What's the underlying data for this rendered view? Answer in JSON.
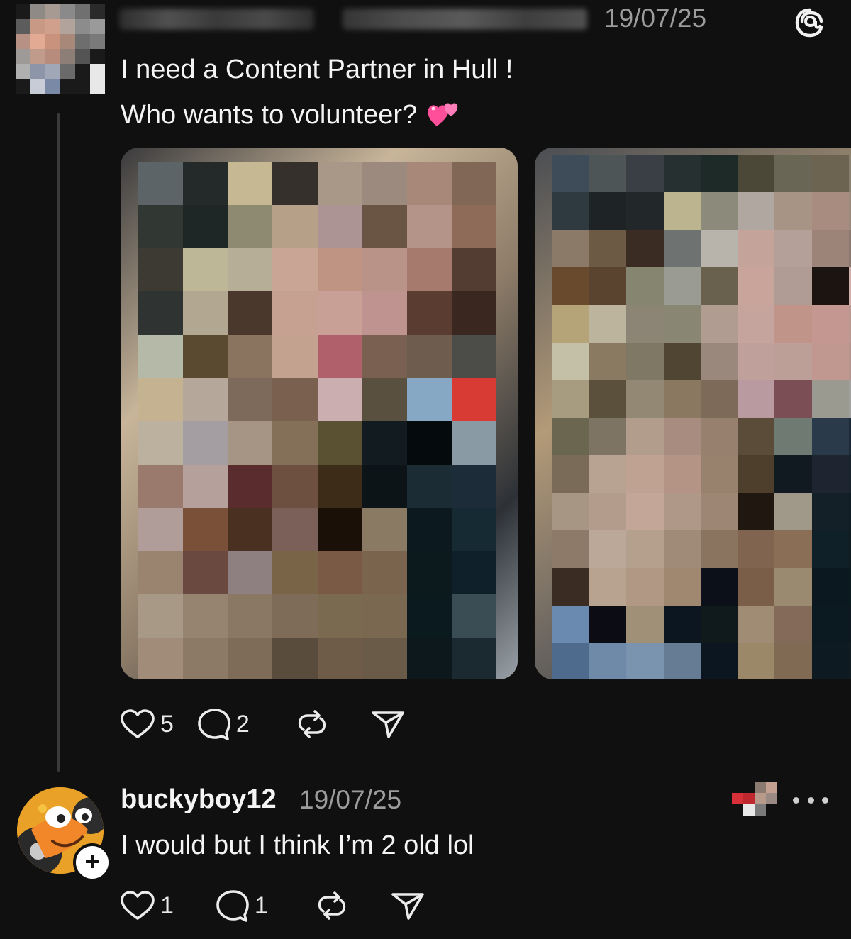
{
  "post": {
    "date": "19/07/25",
    "text_line1": "I need a Content Partner in Hull !",
    "text_line2": "Who wants to volunteer?",
    "emoji_icon": "two-hearts-emoji",
    "author_avatar_icon": "pixelated-avatar",
    "author_name_redacted": true,
    "photos": [
      {
        "name": "photo-1",
        "redacted": true
      },
      {
        "name": "photo-2",
        "redacted": true
      }
    ],
    "actions": {
      "like_count": "5",
      "reply_count": "2",
      "repost_count": "",
      "share_count": ""
    }
  },
  "reply": {
    "username": "buckyboy12",
    "date": "19/07/25",
    "text": "I would but I think I’m 2 old lol",
    "follow_badge": "+",
    "actions": {
      "like_count": "1",
      "reply_count": "1"
    }
  },
  "colors": {
    "background": "#101010",
    "text": "#f3f3f3",
    "muted": "#9c9c9c",
    "thread_line": "#3a3a3a"
  },
  "icons": [
    "threads-logo-icon",
    "heart-icon",
    "comment-icon",
    "repost-icon",
    "share-icon",
    "more-icon"
  ]
}
